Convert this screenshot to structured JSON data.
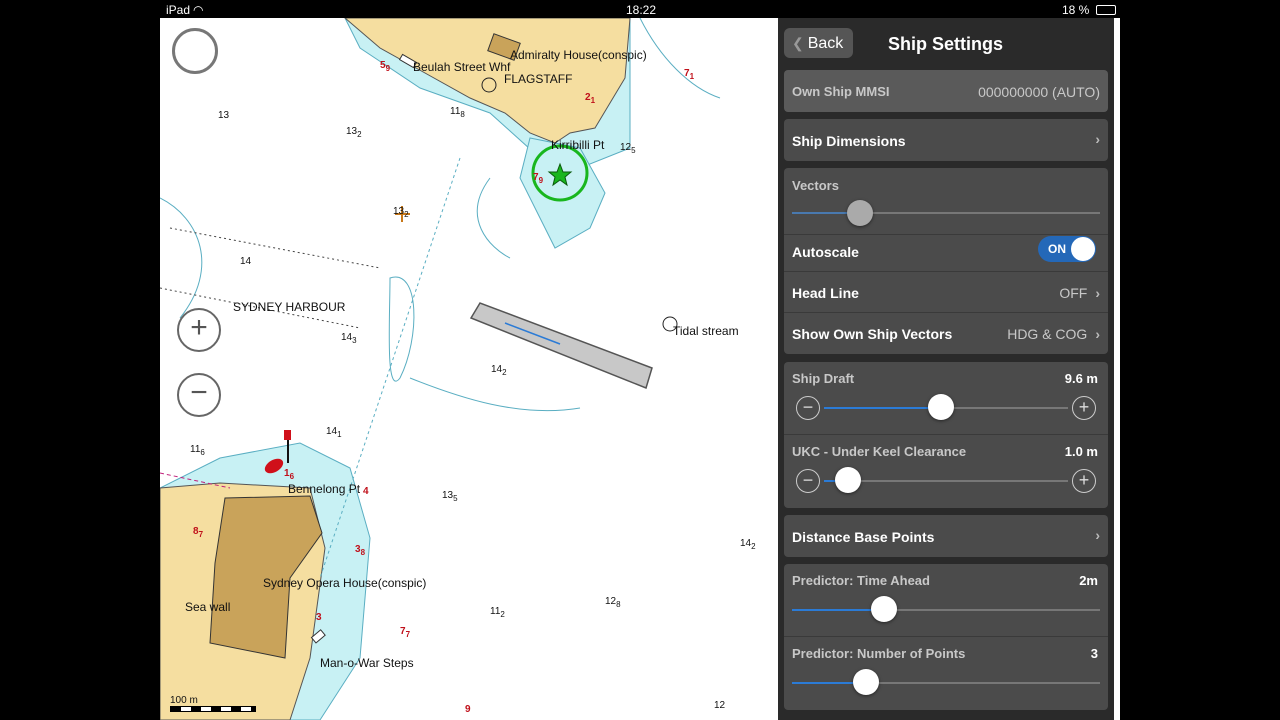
{
  "status_bar": {
    "device": "iPad",
    "time": "18:22",
    "battery": "18 %"
  },
  "map": {
    "labels": {
      "admiralty_house": "Admiralty House(conspic)",
      "beulah_wharf": "Beulah Street Whf",
      "flagstaff": "FLAGSTAFF",
      "kirribilli": "Kirribilli Pt",
      "sydney_harbour": "SYDNEY HARBOUR",
      "tidal_stream": "Tidal stream",
      "bennelong": "Bennelong Pt",
      "opera_house": "Sydney Opera House(conspic)",
      "sea_wall": "Sea wall",
      "man_o_war": "Man-o-War Steps",
      "scale": "100 m"
    },
    "soundings": [
      {
        "main": "13",
        "sub": "",
        "red": false
      },
      {
        "main": "13",
        "sub": "2",
        "red": false
      },
      {
        "main": "11",
        "sub": "8",
        "red": false
      },
      {
        "main": "5",
        "sub": "9",
        "red": true
      },
      {
        "main": "2",
        "sub": "1",
        "red": true
      },
      {
        "main": "7",
        "sub": "1",
        "red": true
      },
      {
        "main": "12",
        "sub": "5",
        "red": false
      },
      {
        "main": "7",
        "sub": "9",
        "red": true
      },
      {
        "main": "13",
        "sub": "2",
        "red": false
      },
      {
        "main": "14",
        "sub": "",
        "red": false
      },
      {
        "main": "14",
        "sub": "3",
        "red": false
      },
      {
        "main": "14",
        "sub": "2",
        "red": false
      },
      {
        "main": "14",
        "sub": "1",
        "red": false
      },
      {
        "main": "11",
        "sub": "6",
        "red": false
      },
      {
        "main": "1",
        "sub": "6",
        "red": true
      },
      {
        "main": "4",
        "sub": "",
        "red": true
      },
      {
        "main": "13",
        "sub": "5",
        "red": false
      },
      {
        "main": "8",
        "sub": "7",
        "red": true
      },
      {
        "main": "3",
        "sub": "8",
        "red": true
      },
      {
        "main": "3",
        "sub": "",
        "red": true
      },
      {
        "main": "7",
        "sub": "7",
        "red": true
      },
      {
        "main": "11",
        "sub": "2",
        "red": false
      },
      {
        "main": "12",
        "sub": "8",
        "red": false
      },
      {
        "main": "9",
        "sub": "",
        "red": true
      },
      {
        "main": "14",
        "sub": "2",
        "red": false
      },
      {
        "main": "12",
        "sub": "",
        "red": false
      }
    ]
  },
  "zoom": {
    "in": "+",
    "out": "−"
  },
  "toolbar": {
    "items": [
      {
        "icon": "crosshair-compass-icon"
      },
      {
        "icon": "warning-triangle-icon"
      },
      {
        "icon": "ship-hull-icon"
      },
      {
        "icon": "chart-page-icon"
      },
      {
        "icon": "steering-wheel-icon"
      },
      {
        "icon": "route-waypoints-icon"
      },
      {
        "icon": "weather-tide-icon"
      },
      {
        "icon": "gears-settings-icon"
      }
    ]
  },
  "panel": {
    "back_label": "Back",
    "title": "Ship Settings",
    "mmsi_label": "Own Ship MMSI",
    "mmsi_value": "000000000 (AUTO)",
    "ship_dimensions": "Ship Dimensions",
    "vectors_label": "Vectors",
    "vectors_level": 0.22,
    "autoscale_label": "Autoscale",
    "autoscale_value": "ON",
    "headline_label": "Head Line",
    "headline_value": "OFF",
    "show_vectors_label": "Show Own Ship Vectors",
    "show_vectors_value": "HDG & COG",
    "draft_label": "Ship Draft",
    "draft_value": "9.6 m",
    "draft_level": 0.48,
    "ukc_label": "UKC - Under Keel Clearance",
    "ukc_value": "1.0 m",
    "ukc_level": 0.1,
    "distance_base_points": "Distance Base Points",
    "time_ahead_label": "Predictor: Time Ahead",
    "time_ahead_value": "2m",
    "time_ahead_level": 0.3,
    "num_points_label": "Predictor: Number of Points",
    "num_points_value": "3",
    "num_points_level": 0.24,
    "minus": "−",
    "plus": "+"
  },
  "colors": {
    "water_shallow": "#c8f1f4",
    "land": "#f5dea0",
    "building": "#c9a35a",
    "accent": "#2b7bd6",
    "toggle_on": "#2468b8"
  }
}
